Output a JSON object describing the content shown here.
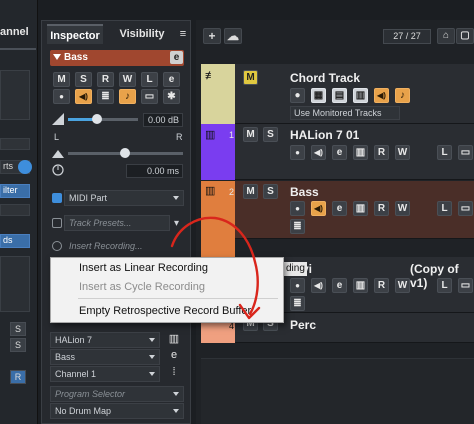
{
  "left_strip": {
    "title": "annel",
    "labels": [
      "rts",
      "ilter",
      "ds"
    ],
    "letters": [
      "S",
      "S",
      "R"
    ]
  },
  "inspector": {
    "tabs": [
      "Inspector",
      "Visibility",
      "≡"
    ],
    "track_name": "Bass",
    "buttons_row1": [
      "M",
      "S",
      "R",
      "W",
      "L",
      "e"
    ],
    "buttons_row2": [
      "●",
      "◀)",
      "≣",
      "♪",
      "▭",
      "✱"
    ],
    "volume_value": "0.00 dB",
    "pan_value": "0.00",
    "delay_value": "0.00 ms",
    "pan_left": "L",
    "pan_right": "R",
    "midi_part": "MIDI Part",
    "track_presets_placeholder": "Track Presets...",
    "insert_recording_placeholder": "Insert Recording...",
    "instrument": "HALion 7",
    "patch": "Bass",
    "channel": "Channel 1",
    "program_selector_placeholder": "Program Selector",
    "drum_map": "No Drum Map"
  },
  "toolbar": {
    "add_label": "+",
    "counter": "27 / 27"
  },
  "tracks": [
    {
      "number": "",
      "name": "Chord Track",
      "mute_label": "M",
      "sub": "Use Monitored Tracks",
      "color": "#d8d49c"
    },
    {
      "number": "1",
      "name": "HALion 7 01",
      "color": "#7a3df0"
    },
    {
      "number": "2",
      "name": "Bass",
      "color": "#e07e3e"
    },
    {
      "number": "",
      "name": "vi",
      "extra": "(Copy of v1)",
      "color": "#e07e3e"
    },
    {
      "number": "4",
      "name": "Perc",
      "color": "#f0a080"
    }
  ],
  "track_buttons": [
    "M",
    "S",
    "R",
    "W",
    "L",
    "e"
  ],
  "context_menu": {
    "items": [
      {
        "label": "Insert as Linear Recording",
        "enabled": true
      },
      {
        "label": "Insert as Cycle Recording",
        "enabled": false
      },
      {
        "label": "Empty Retrospective Record Buffer",
        "enabled": true
      }
    ],
    "partial_label": "ding"
  },
  "colors": {
    "accent_orange": "#e8a24a",
    "annotation_red": "#d9261c",
    "track_bass": "#a0472f"
  }
}
